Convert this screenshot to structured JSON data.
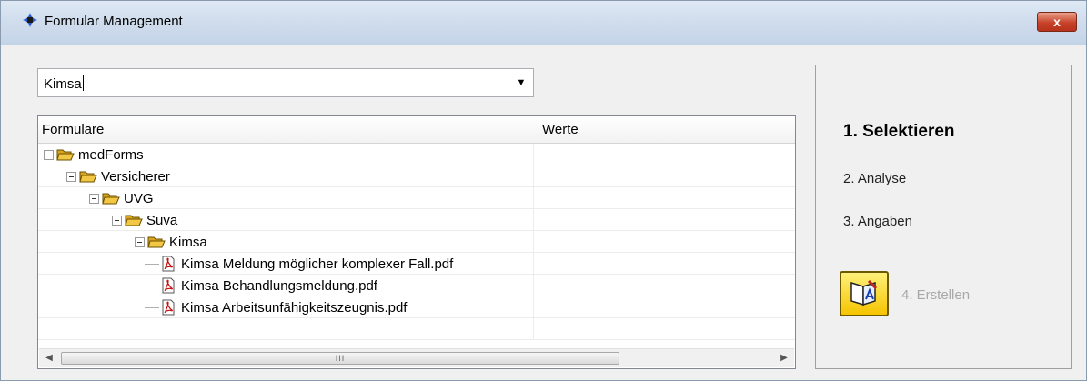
{
  "window": {
    "title": "Formular Management",
    "close_label": "x"
  },
  "search": {
    "value": "Kimsa"
  },
  "tree": {
    "columns": [
      "Formulare",
      "Werte"
    ],
    "nodes": [
      {
        "label": "medForms",
        "icon": "folder-open-icon",
        "level": 0,
        "expanded": true
      },
      {
        "label": "Versicherer",
        "icon": "folder-open-icon",
        "level": 1,
        "expanded": true
      },
      {
        "label": "UVG",
        "icon": "folder-open-icon",
        "level": 2,
        "expanded": true
      },
      {
        "label": "Suva",
        "icon": "folder-open-icon",
        "level": 3,
        "expanded": true
      },
      {
        "label": "Kimsa",
        "icon": "folder-open-icon",
        "level": 4,
        "expanded": true
      },
      {
        "label": "Kimsa Meldung möglicher komplexer Fall.pdf",
        "icon": "pdf-icon",
        "level": 5
      },
      {
        "label": "Kimsa Behandlungsmeldung.pdf",
        "icon": "pdf-icon",
        "level": 5
      },
      {
        "label": "Kimsa Arbeitsunfähigkeitszeugnis.pdf",
        "icon": "pdf-icon",
        "level": 5
      }
    ],
    "scroll_thumb_label": "III"
  },
  "steps": {
    "step1": "1. Selektieren",
    "step2": "2. Analyse",
    "step3": "3. Angaben",
    "step4": "4. Erstellen"
  },
  "colors": {
    "close": "#c8432a",
    "create_button": "#f5c400",
    "folder": "#f2c744"
  }
}
